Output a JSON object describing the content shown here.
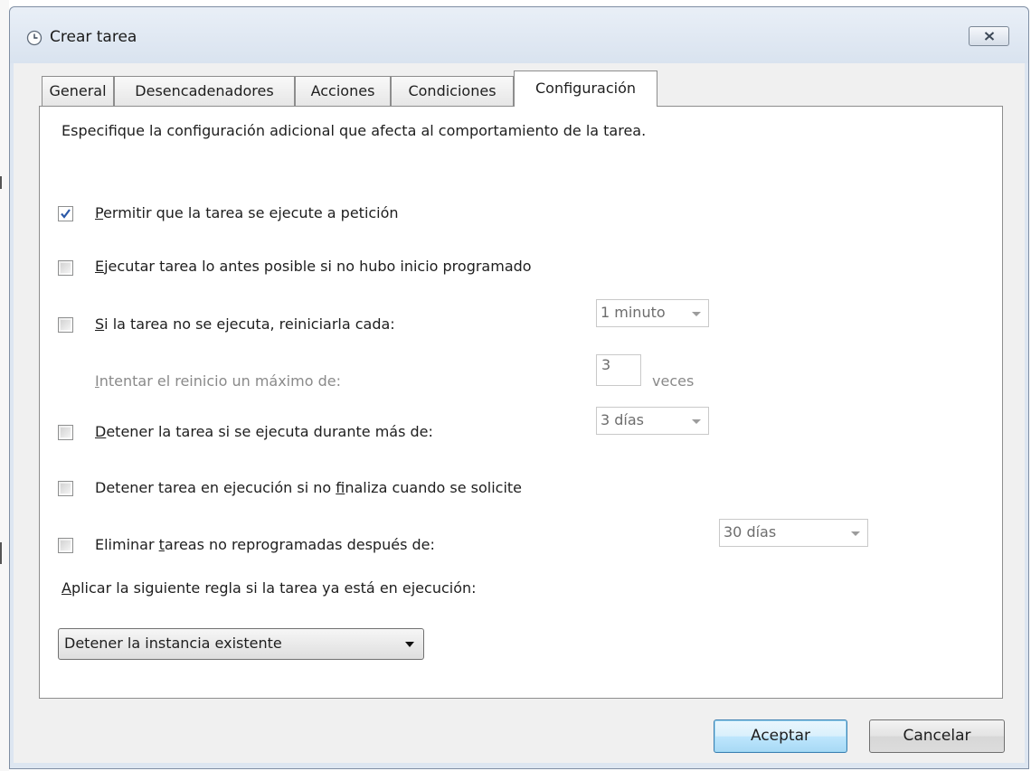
{
  "window": {
    "title": "Crear tarea",
    "close_icon": "close-icon"
  },
  "tabs": [
    {
      "label": "General",
      "active": false
    },
    {
      "label": "Desencadenadores",
      "active": false
    },
    {
      "label": "Acciones",
      "active": false
    },
    {
      "label": "Condiciones",
      "active": false
    },
    {
      "label": "Configuración",
      "active": true
    }
  ],
  "settings": {
    "description": "Especifique la configuración adicional que afecta al comportamiento de la tarea.",
    "allow_on_demand": {
      "u": "P",
      "rest": "ermitir que la tarea se ejecute a petición",
      "checked": true
    },
    "run_asap": {
      "u": "E",
      "rest": "jecutar tarea lo antes posible si no hubo inicio programado",
      "checked": false
    },
    "restart": {
      "u": "S",
      "rest": "i la tarea no se ejecuta, reiniciarla cada:",
      "checked": false,
      "interval": "1 minuto"
    },
    "restart_attempts": {
      "u": "I",
      "rest": "ntentar el reinicio un máximo de:",
      "value": "3",
      "unit": "veces"
    },
    "stop_long": {
      "u": "D",
      "rest": "etener la tarea si se ejecuta durante más de:",
      "checked": false,
      "duration": "3 días"
    },
    "force_stop": {
      "pre": "Detener tarea en ejecución si no ",
      "u": "f",
      "post": "inaliza cuando se solicite",
      "checked": false
    },
    "delete_task": {
      "pre": "Eliminar ",
      "u": "t",
      "post": "areas no reprogramadas después de:",
      "checked": false,
      "duration": "30 días"
    },
    "rule": {
      "u": "A",
      "rest": "plicar la siguiente regla si la tarea ya está en ejecución:",
      "value": "Detener la instancia existente"
    }
  },
  "buttons": {
    "ok": "Aceptar",
    "cancel": "Cancelar"
  },
  "colors": {
    "frame": "#dde6f1",
    "body": "#f0f0f0",
    "default_button": "#3c7fb1",
    "check": "#2b59a8"
  }
}
